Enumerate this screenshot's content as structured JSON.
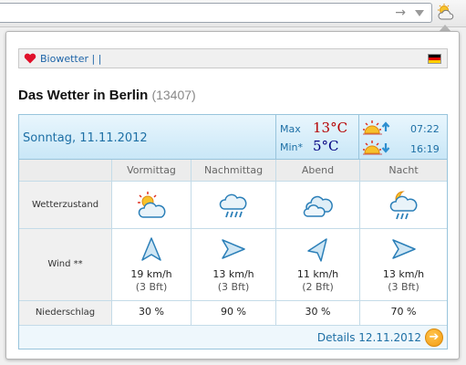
{
  "browser": {
    "go_icon": "right-arrow-icon",
    "dropdown_icon": "dropdown-arrow-icon",
    "extension_icon": "sun-cloud-icon"
  },
  "panel": {
    "topbar": {
      "heart_icon": "heart-icon",
      "link_text": "Biowetter | |",
      "flag_icon": "german-flag-icon",
      "flag_colors": [
        "#000000",
        "#dd0000",
        "#ffce00"
      ]
    },
    "title": "Das Wetter in Berlin",
    "zip": "(13407)"
  },
  "forecast": {
    "date": "Sonntag, 11.11.2012",
    "max_label": "Max",
    "max_temp": "13°C",
    "min_label": "Min*",
    "min_temp": "5°C",
    "sunrise": "07:22",
    "sunset": "16:19",
    "periods": [
      "Vormittag",
      "Nachmittag",
      "Abend",
      "Nacht"
    ],
    "row_labels": {
      "condition": "Wetterzustand",
      "wind": "Wind **",
      "precip": "Niederschlag"
    },
    "conditions": [
      {
        "icon": "sun-cloud-icon"
      },
      {
        "icon": "rain-cloud-icon"
      },
      {
        "icon": "cloud-icon"
      },
      {
        "icon": "moon-rain-cloud-icon"
      }
    ],
    "wind": [
      {
        "speed": "19 km/h",
        "bft": "(3 Bft)",
        "icon": "wind-arrow-icon"
      },
      {
        "speed": "13 km/h",
        "bft": "(3 Bft)",
        "icon": "wind-arrow-icon"
      },
      {
        "speed": "11 km/h",
        "bft": "(2 Bft)",
        "icon": "wind-arrow-icon"
      },
      {
        "speed": "13 km/h",
        "bft": "(3 Bft)",
        "icon": "wind-arrow-icon"
      }
    ],
    "precip": [
      "30 %",
      "90 %",
      "30 %",
      "70 %"
    ],
    "details_link": "Details 12.11.2012",
    "details_icon": "arrow-right-circle-icon",
    "colors": {
      "accent": "#1d6fa5",
      "max_temp": "#b50000",
      "min_temp": "#000080",
      "header_bg": "#c9e7f7",
      "details_button": "#f39c12"
    }
  }
}
